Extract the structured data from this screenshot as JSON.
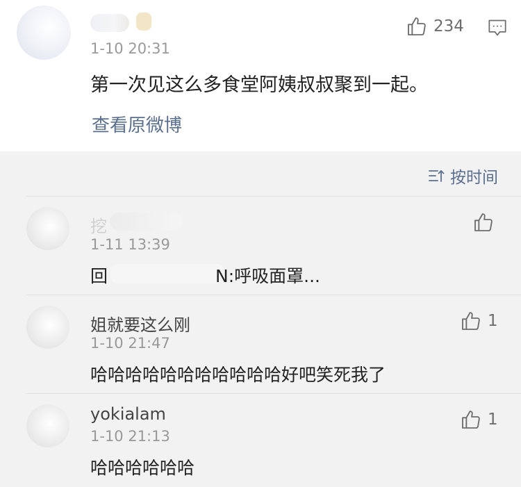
{
  "main_comment": {
    "like_count": "234",
    "timestamp": "1-10 20:31",
    "text": "第一次见这么多食堂阿姨叔叔聚到一起。",
    "view_original": "查看原微博"
  },
  "sort": {
    "label": "按时间"
  },
  "replies": [
    {
      "username": "挖",
      "timestamp": "1-11 13:39",
      "text_prefix": "回",
      "text_suffix": "N:呼吸面罩...",
      "like_count": ""
    },
    {
      "username": "姐就要这么刚",
      "timestamp": "1-10 21:47",
      "text": "哈哈哈哈哈哈哈哈哈哈哈好吧笑死我了",
      "like_count": "1"
    },
    {
      "username": "yokialam",
      "timestamp": "1-10 21:13",
      "text": "哈哈哈哈哈哈",
      "like_count": "1"
    }
  ],
  "colors": {
    "link": "#5b6f8e",
    "muted": "#999999",
    "text": "#222222",
    "background": "#f2f2f2"
  },
  "icons": [
    "thumbs-up-icon",
    "comment-icon",
    "sort-icon"
  ]
}
